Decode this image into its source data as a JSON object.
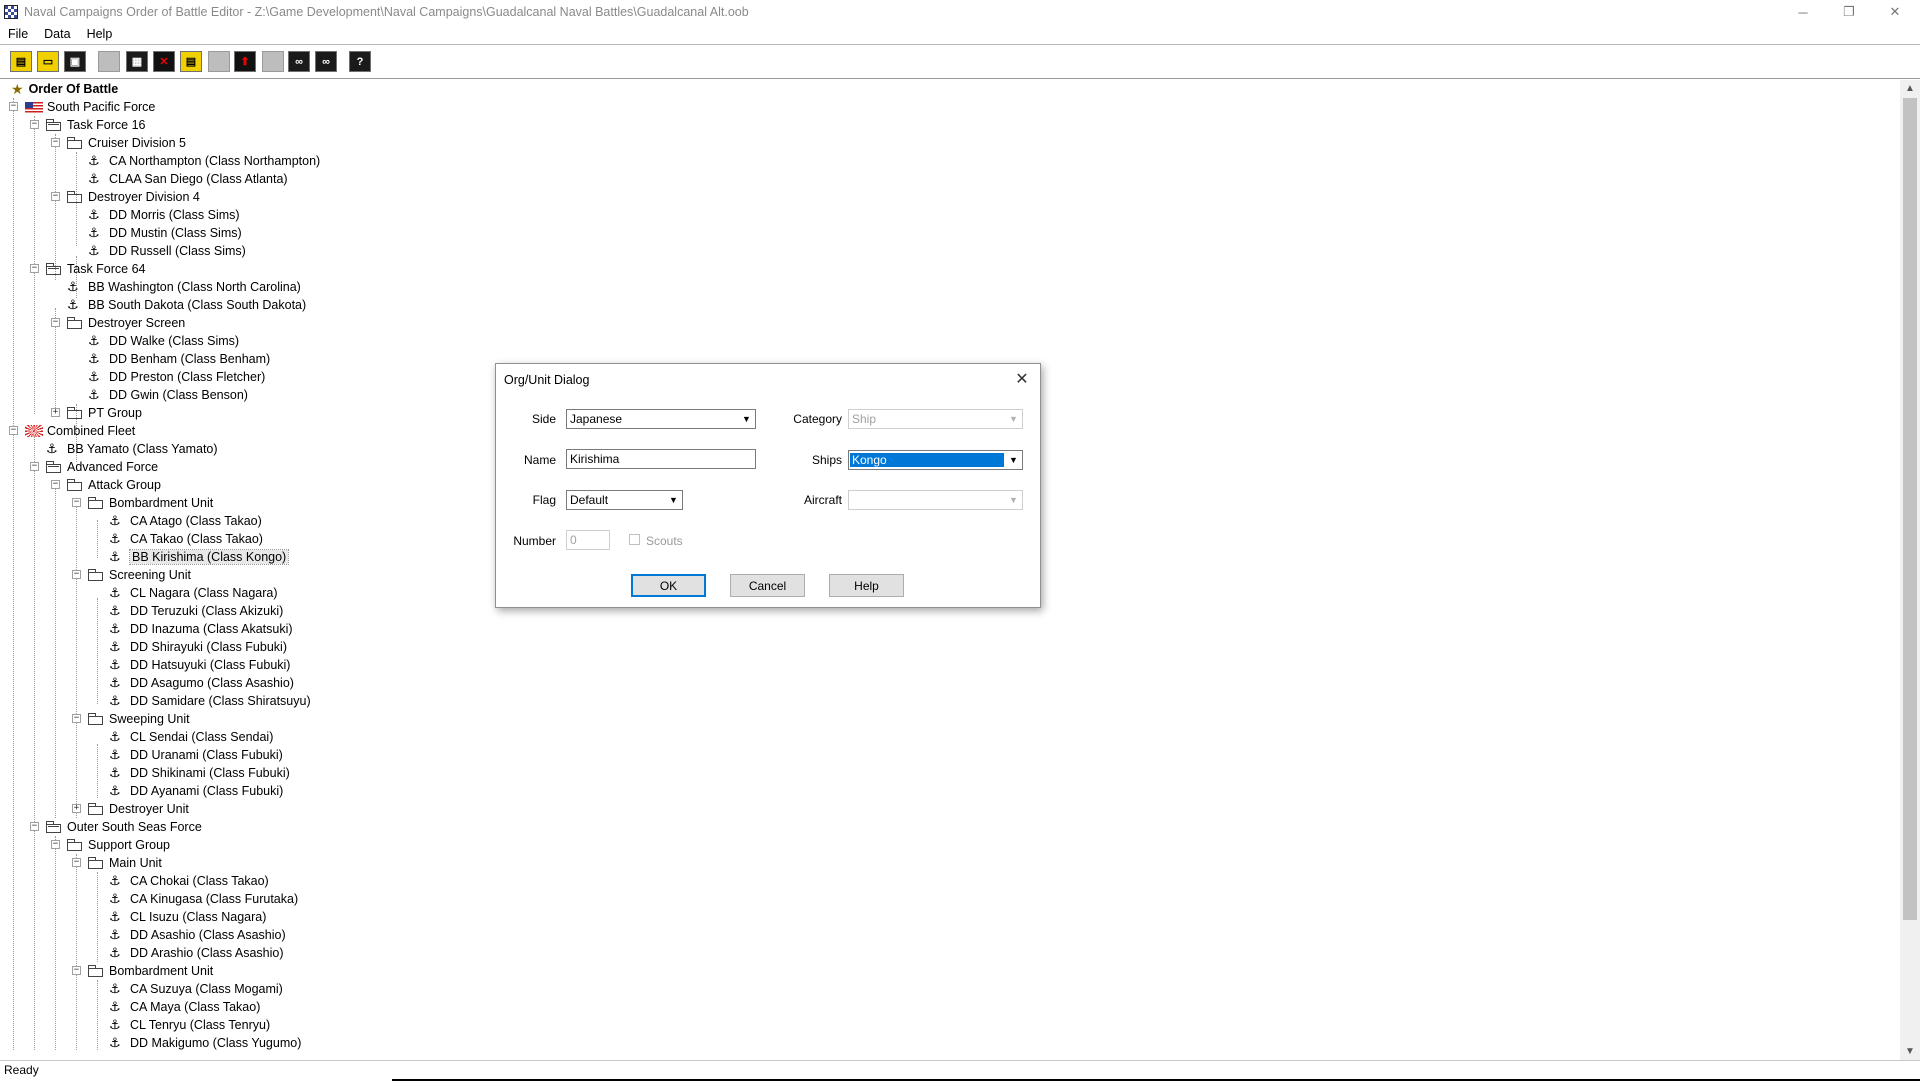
{
  "window": {
    "title": "Naval Campaigns Order of Battle Editor - Z:\\Game Development\\Naval Campaigns\\Guadalcanal Naval Battles\\Guadalcanal Alt.oob",
    "minimize_glyph": "─",
    "maximize_glyph": "❐",
    "close_glyph": "✕"
  },
  "menu": [
    "File",
    "Data",
    "Help"
  ],
  "toolbar": [
    {
      "icon": "new-file-icon",
      "glyph": "▤",
      "style": "yellow"
    },
    {
      "icon": "open-folder-icon",
      "glyph": "▭",
      "style": "yellow"
    },
    {
      "icon": "save-icon",
      "glyph": "▣",
      "style": "dark"
    },
    {
      "icon": "blank-icon",
      "glyph": "",
      "style": "gray"
    },
    {
      "icon": "document-icon",
      "glyph": "▦",
      "style": "dark"
    },
    {
      "icon": "delete-icon",
      "glyph": "✕",
      "style": "red"
    },
    {
      "icon": "edit-icon",
      "glyph": "▤",
      "style": "yellow"
    },
    {
      "icon": "blank-icon",
      "glyph": "",
      "style": "gray"
    },
    {
      "icon": "move-up-icon",
      "glyph": "⬆",
      "style": "red"
    },
    {
      "icon": "blank-icon",
      "glyph": "",
      "style": "gray"
    },
    {
      "icon": "link-icon",
      "glyph": "∞",
      "style": "dark"
    },
    {
      "icon": "link-alt-icon",
      "glyph": "∞",
      "style": "dark"
    },
    {
      "icon": "help-icon",
      "glyph": "?",
      "style": "dark"
    }
  ],
  "tree": [
    {
      "label": "Order Of Battle",
      "level": 0,
      "icon": "star",
      "bold": true,
      "expander": ""
    },
    {
      "label": "South Pacific Force",
      "level": 0,
      "icon": "flag-us",
      "expander": "-"
    },
    {
      "label": "Task Force 16",
      "level": 1,
      "icon": "folder-tf",
      "expander": "-"
    },
    {
      "label": "Cruiser Division 5",
      "level": 2,
      "icon": "folder",
      "expander": "-"
    },
    {
      "label": "CA Northampton (Class Northampton)",
      "level": 3,
      "icon": "anchor"
    },
    {
      "label": "CLAA San Diego (Class Atlanta)",
      "level": 3,
      "icon": "anchor"
    },
    {
      "label": "Destroyer Division 4",
      "level": 2,
      "icon": "folder",
      "expander": "-"
    },
    {
      "label": "DD Morris (Class Sims)",
      "level": 3,
      "icon": "anchor"
    },
    {
      "label": "DD Mustin (Class Sims)",
      "level": 3,
      "icon": "anchor"
    },
    {
      "label": "DD Russell (Class Sims)",
      "level": 3,
      "icon": "anchor"
    },
    {
      "label": "Task Force 64",
      "level": 1,
      "icon": "folder-tf",
      "expander": "-"
    },
    {
      "label": "BB Washington (Class North Carolina)",
      "level": 2,
      "icon": "anchor"
    },
    {
      "label": "BB South Dakota (Class South Dakota)",
      "level": 2,
      "icon": "anchor"
    },
    {
      "label": "Destroyer Screen",
      "level": 2,
      "icon": "folder",
      "expander": "-"
    },
    {
      "label": "DD Walke (Class Sims)",
      "level": 3,
      "icon": "anchor"
    },
    {
      "label": "DD Benham (Class Benham)",
      "level": 3,
      "icon": "anchor"
    },
    {
      "label": "DD Preston (Class Fletcher)",
      "level": 3,
      "icon": "anchor"
    },
    {
      "label": "DD Gwin (Class Benson)",
      "level": 3,
      "icon": "anchor"
    },
    {
      "label": "PT Group",
      "level": 2,
      "icon": "folder",
      "expander": "+"
    },
    {
      "label": "Combined Fleet",
      "level": 0,
      "icon": "flag-jp",
      "expander": "-"
    },
    {
      "label": "BB Yamato (Class Yamato)",
      "level": 1,
      "icon": "anchor"
    },
    {
      "label": "Advanced Force",
      "level": 1,
      "icon": "folder-tf",
      "expander": "-"
    },
    {
      "label": "Attack Group",
      "level": 2,
      "icon": "folder",
      "expander": "-"
    },
    {
      "label": "Bombardment Unit",
      "level": 3,
      "icon": "folder",
      "expander": "-"
    },
    {
      "label": "CA Atago (Class Takao)",
      "level": 4,
      "icon": "anchor"
    },
    {
      "label": "CA Takao (Class Takao)",
      "level": 4,
      "icon": "anchor"
    },
    {
      "label": "BB Kirishima (Class Kongo)",
      "level": 4,
      "icon": "anchor",
      "selected": true
    },
    {
      "label": "Screening Unit",
      "level": 3,
      "icon": "folder",
      "expander": "-"
    },
    {
      "label": "CL Nagara (Class Nagara)",
      "level": 4,
      "icon": "anchor"
    },
    {
      "label": "DD Teruzuki (Class Akizuki)",
      "level": 4,
      "icon": "anchor"
    },
    {
      "label": "DD Inazuma (Class Akatsuki)",
      "level": 4,
      "icon": "anchor"
    },
    {
      "label": "DD Shirayuki (Class Fubuki)",
      "level": 4,
      "icon": "anchor"
    },
    {
      "label": "DD Hatsuyuki (Class Fubuki)",
      "level": 4,
      "icon": "anchor"
    },
    {
      "label": "DD Asagumo (Class Asashio)",
      "level": 4,
      "icon": "anchor"
    },
    {
      "label": "DD Samidare (Class Shiratsuyu)",
      "level": 4,
      "icon": "anchor"
    },
    {
      "label": "Sweeping Unit",
      "level": 3,
      "icon": "folder",
      "expander": "-"
    },
    {
      "label": "CL Sendai (Class Sendai)",
      "level": 4,
      "icon": "anchor"
    },
    {
      "label": "DD Uranami (Class Fubuki)",
      "level": 4,
      "icon": "anchor"
    },
    {
      "label": "DD Shikinami (Class Fubuki)",
      "level": 4,
      "icon": "anchor"
    },
    {
      "label": "DD Ayanami (Class Fubuki)",
      "level": 4,
      "icon": "anchor"
    },
    {
      "label": "Destroyer Unit",
      "level": 3,
      "icon": "folder",
      "expander": "+"
    },
    {
      "label": "Outer South Seas Force",
      "level": 1,
      "icon": "folder-tf",
      "expander": "-"
    },
    {
      "label": "Support Group",
      "level": 2,
      "icon": "folder",
      "expander": "-"
    },
    {
      "label": "Main Unit",
      "level": 3,
      "icon": "folder",
      "expander": "-"
    },
    {
      "label": "CA Chokai (Class Takao)",
      "level": 4,
      "icon": "anchor"
    },
    {
      "label": "CA Kinugasa (Class Furutaka)",
      "level": 4,
      "icon": "anchor"
    },
    {
      "label": "CL Isuzu (Class Nagara)",
      "level": 4,
      "icon": "anchor"
    },
    {
      "label": "DD Asashio (Class Asashio)",
      "level": 4,
      "icon": "anchor"
    },
    {
      "label": "DD Arashio (Class Asashio)",
      "level": 4,
      "icon": "anchor"
    },
    {
      "label": "Bombardment Unit",
      "level": 3,
      "icon": "folder",
      "expander": "-"
    },
    {
      "label": "CA Suzuya (Class Mogami)",
      "level": 4,
      "icon": "anchor"
    },
    {
      "label": "CA Maya (Class Takao)",
      "level": 4,
      "icon": "anchor"
    },
    {
      "label": "CL Tenryu (Class Tenryu)",
      "level": 4,
      "icon": "anchor"
    },
    {
      "label": "DD Makigumo (Class Yugumo)",
      "level": 4,
      "icon": "anchor"
    }
  ],
  "status": {
    "text": "Ready"
  },
  "dialog": {
    "title": "Org/Unit Dialog",
    "close_glyph": "✕",
    "side_label": "Side",
    "side_value": "Japanese",
    "category_label": "Category",
    "category_value": "Ship",
    "name_label": "Name",
    "name_value": "Kirishima",
    "ships_label": "Ships",
    "ships_value": "Kongo",
    "flag_label": "Flag",
    "flag_value": "Default",
    "aircraft_label": "Aircraft",
    "aircraft_value": "",
    "number_label": "Number",
    "number_value": "0",
    "scouts_label": "Scouts",
    "ok_label": "OK",
    "cancel_label": "Cancel",
    "help_label": "Help",
    "dropdown_glyph": "▼"
  }
}
